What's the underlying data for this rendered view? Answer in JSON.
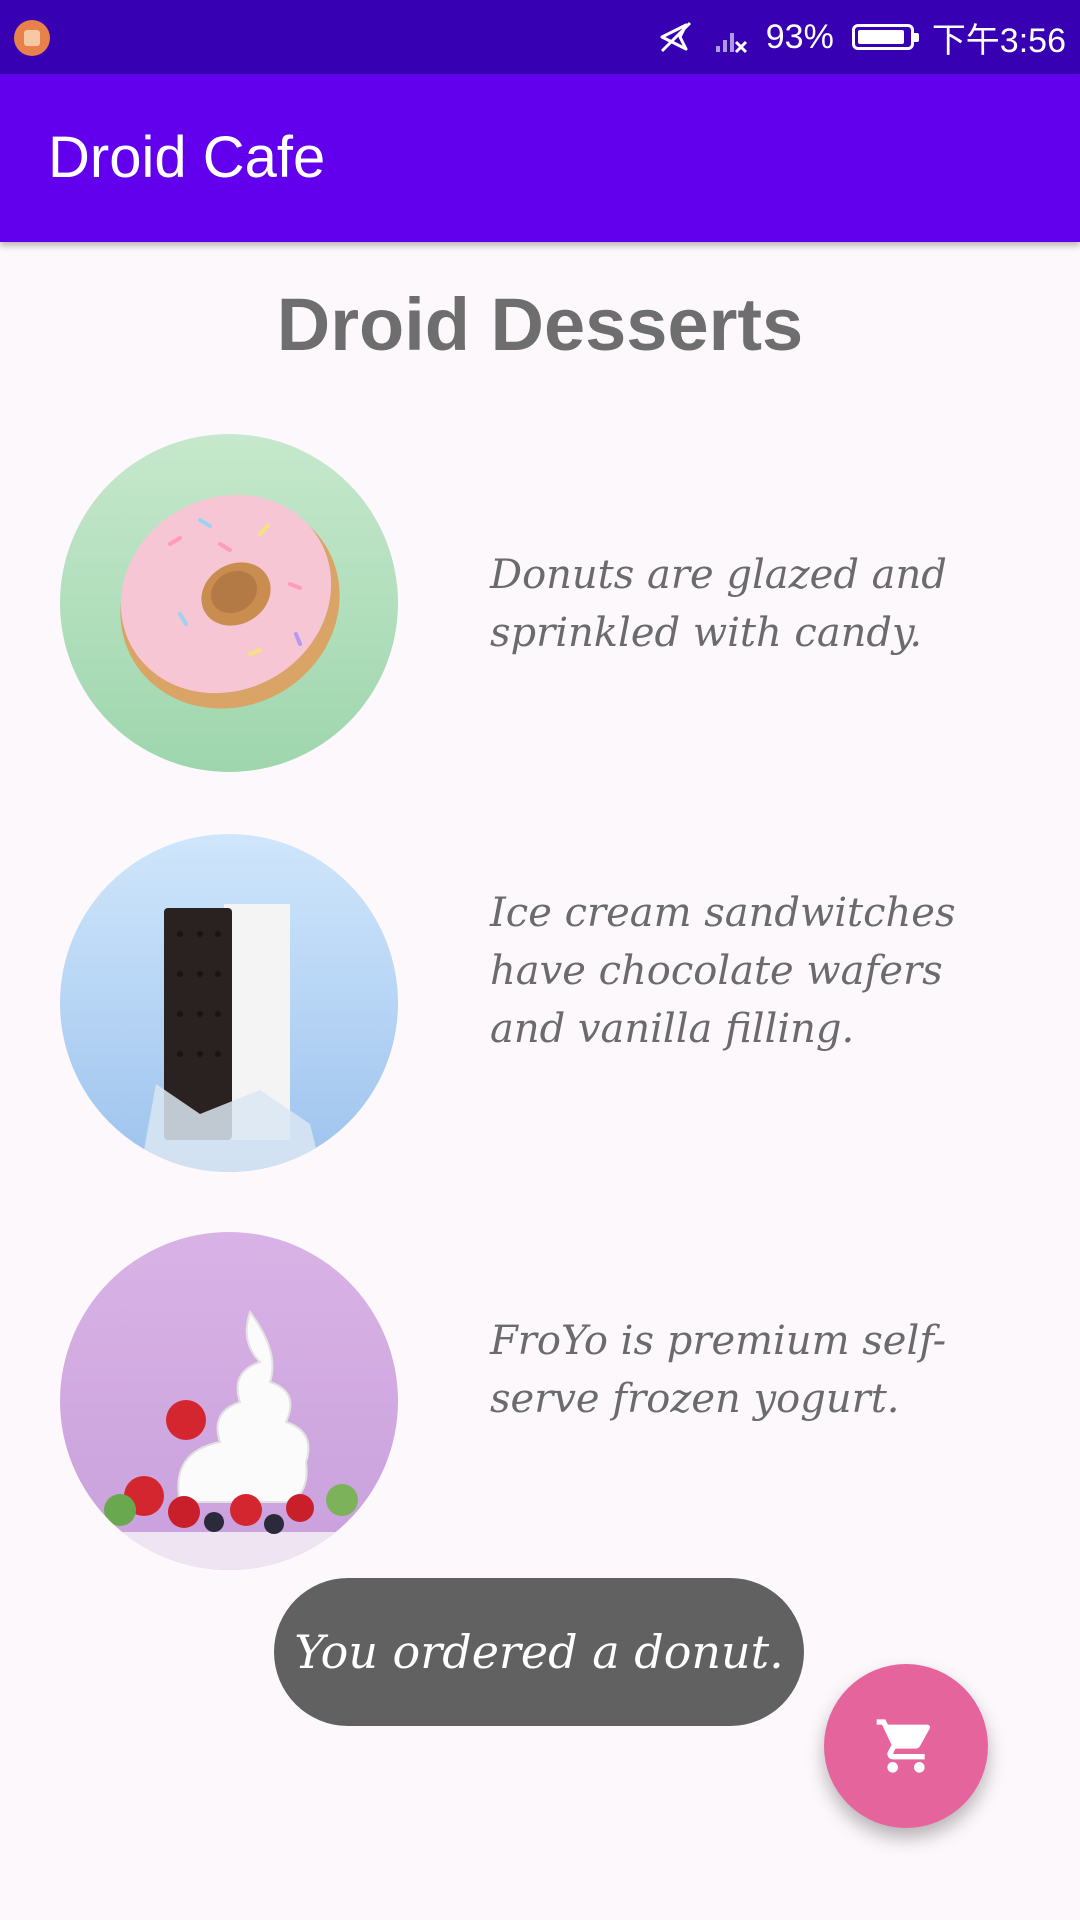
{
  "status_bar": {
    "battery": "93%",
    "battery_level": 0.93,
    "time": "下午3:56",
    "icons": [
      "app-notification-icon",
      "mute-icon",
      "signal-icon",
      "battery-icon"
    ]
  },
  "app_bar": {
    "title": "Droid Cafe"
  },
  "page": {
    "title": "Droid Desserts"
  },
  "desserts": [
    {
      "name": "donut",
      "description": "Donuts are glazed and sprinkled with candy."
    },
    {
      "name": "ice-cream-sandwich",
      "description": "Ice cream sandwitches have chocolate wafers and vanilla filling."
    },
    {
      "name": "froyo",
      "description": "FroYo is premium self-serve frozen yogurt."
    }
  ],
  "toast": {
    "message": "You ordered a donut."
  },
  "fab": {
    "icon": "shopping-cart-icon"
  },
  "colors": {
    "status_bar": "#3700b3",
    "app_bar": "#6200ee",
    "fab": "#e6649c",
    "toast": "#616161"
  }
}
